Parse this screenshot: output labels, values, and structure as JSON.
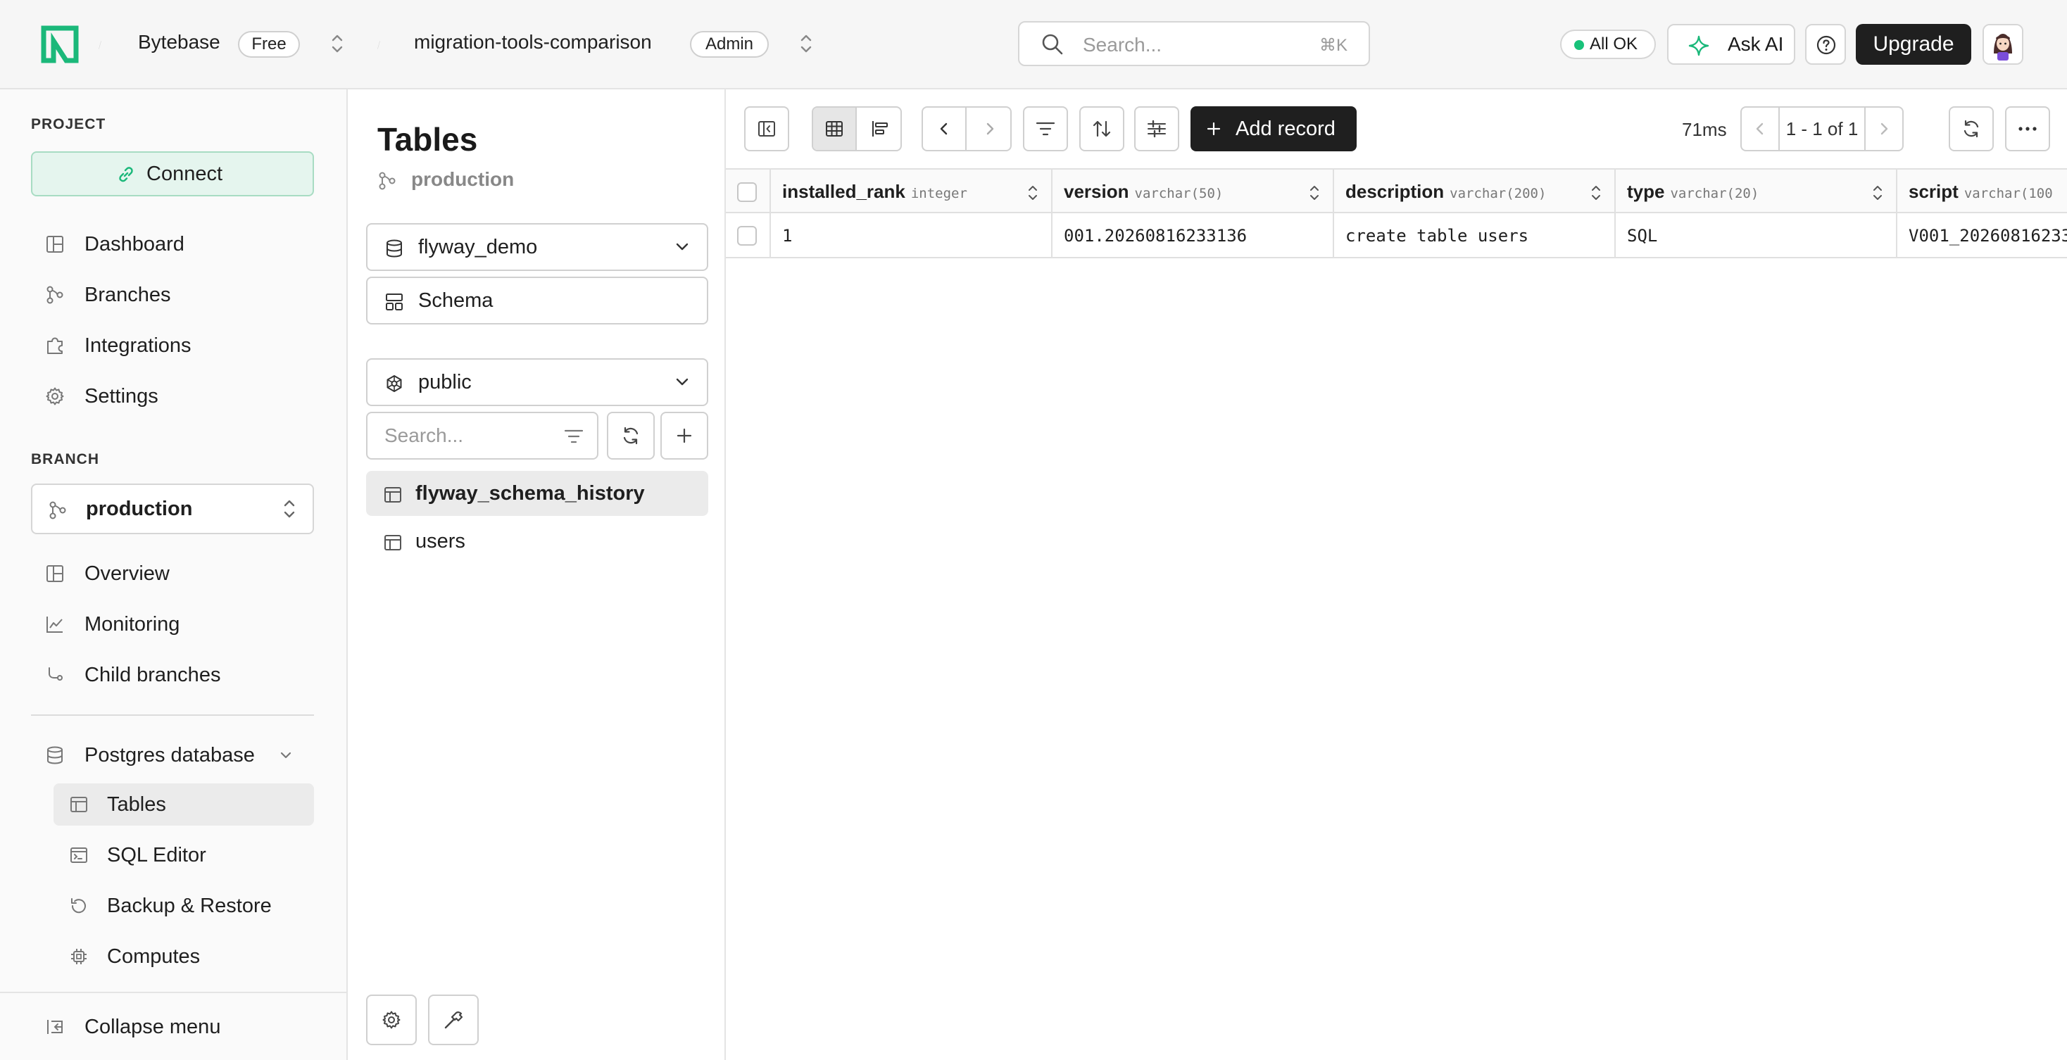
{
  "topbar": {
    "org_name": "Bytebase",
    "plan_badge": "Free",
    "project_name": "migration-tools-comparison",
    "role_badge": "Admin",
    "search_placeholder": "Search...",
    "search_shortcut": "⌘K",
    "status_label": "All OK",
    "ask_ai_label": "Ask AI",
    "upgrade_label": "Upgrade",
    "colors": {
      "status_dot": "#18c27a",
      "brand": "#1bb87a"
    }
  },
  "sidebar": {
    "project_section_label": "PROJECT",
    "connect_label": "Connect",
    "project_items": [
      {
        "label": "Dashboard",
        "icon": "dashboard-icon"
      },
      {
        "label": "Branches",
        "icon": "branch-icon"
      },
      {
        "label": "Integrations",
        "icon": "puzzle-icon"
      },
      {
        "label": "Settings",
        "icon": "gear-icon"
      }
    ],
    "branch_section_label": "BRANCH",
    "branch_selected": "production",
    "branch_items": [
      {
        "label": "Overview",
        "icon": "dashboard-icon"
      },
      {
        "label": "Monitoring",
        "icon": "chart-line-icon"
      },
      {
        "label": "Child branches",
        "icon": "child-branch-icon"
      }
    ],
    "database_group_label": "Postgres database",
    "database_items": [
      {
        "label": "Tables",
        "icon": "table-icon",
        "active": true
      },
      {
        "label": "SQL Editor",
        "icon": "terminal-icon",
        "active": false
      },
      {
        "label": "Backup & Restore",
        "icon": "restore-icon",
        "active": false
      },
      {
        "label": "Computes",
        "icon": "chip-icon",
        "active": false
      }
    ],
    "collapse_label": "Collapse menu"
  },
  "tables_panel": {
    "title": "Tables",
    "branch_label": "production",
    "database_selected": "flyway_demo",
    "schema_button_label": "Schema",
    "schema_selected": "public",
    "search_placeholder": "Search...",
    "tables": [
      {
        "name": "flyway_schema_history",
        "active": true
      },
      {
        "name": "users",
        "active": false
      }
    ]
  },
  "data_view": {
    "add_record_label": "Add record",
    "query_time": "71ms",
    "pagination_label": "1 - 1 of 1",
    "columns": [
      {
        "name": "installed_rank",
        "type": "integer"
      },
      {
        "name": "version",
        "type": "varchar(50)"
      },
      {
        "name": "description",
        "type": "varchar(200)"
      },
      {
        "name": "type",
        "type": "varchar(20)"
      },
      {
        "name": "script",
        "type": "varchar(100"
      }
    ],
    "rows": [
      {
        "cells": [
          "1",
          "001.20260816233136",
          "create table users",
          "SQL",
          "V001_20260816233"
        ]
      }
    ]
  }
}
